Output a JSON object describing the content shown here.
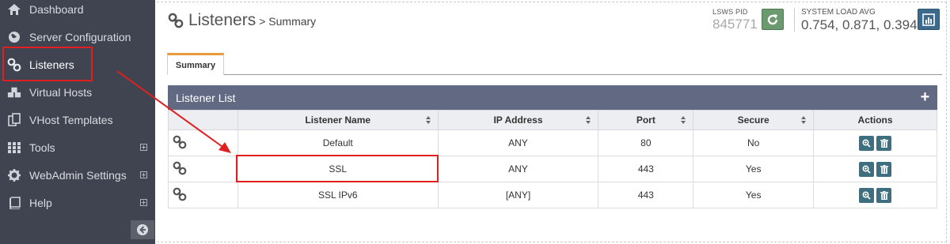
{
  "sidebar": {
    "items": [
      {
        "label": "Dashboard",
        "icon": "home-icon",
        "expandable": false
      },
      {
        "label": "Server Configuration",
        "icon": "globe-icon",
        "expandable": false
      },
      {
        "label": "Listeners",
        "icon": "link-icon",
        "expandable": false,
        "active": true
      },
      {
        "label": "Virtual Hosts",
        "icon": "cubes-icon",
        "expandable": false
      },
      {
        "label": "VHost Templates",
        "icon": "copy-icon",
        "expandable": false
      },
      {
        "label": "Tools",
        "icon": "grid-icon",
        "expandable": true
      },
      {
        "label": "WebAdmin Settings",
        "icon": "gear-icon",
        "expandable": true
      },
      {
        "label": "Help",
        "icon": "book-icon",
        "expandable": true
      }
    ],
    "collapse_icon": "arrow-left-circle-icon"
  },
  "header": {
    "title": "Listeners",
    "breadcrumb": "> Summary",
    "pid_caption": "LSWS PID",
    "pid_value": "845771",
    "load_caption": "SYSTEM LOAD AVG",
    "load_value": "0.754, 0.871, 0.394"
  },
  "tabs": [
    {
      "label": "Summary",
      "active": true
    }
  ],
  "panel": {
    "title": "Listener List",
    "add_label": "+"
  },
  "table": {
    "columns": [
      "",
      "Listener Name",
      "IP Address",
      "Port",
      "Secure",
      "Actions"
    ],
    "rows": [
      {
        "name": "Default",
        "ip": "ANY",
        "port": "80",
        "secure": "No"
      },
      {
        "name": "SSL",
        "ip": "ANY",
        "port": "443",
        "secure": "Yes"
      },
      {
        "name": "SSL IPv6",
        "ip": "[ANY]",
        "port": "443",
        "secure": "Yes"
      }
    ]
  },
  "colors": {
    "sidebar_bg": "#3f4450",
    "panel_header": "#616a82",
    "tab_accent": "#e99a3a",
    "restart_btn": "#6a9a6e",
    "stats_btn": "#3b6a8c",
    "action_btn": "#3d6f80",
    "highlight": "#e02020"
  }
}
